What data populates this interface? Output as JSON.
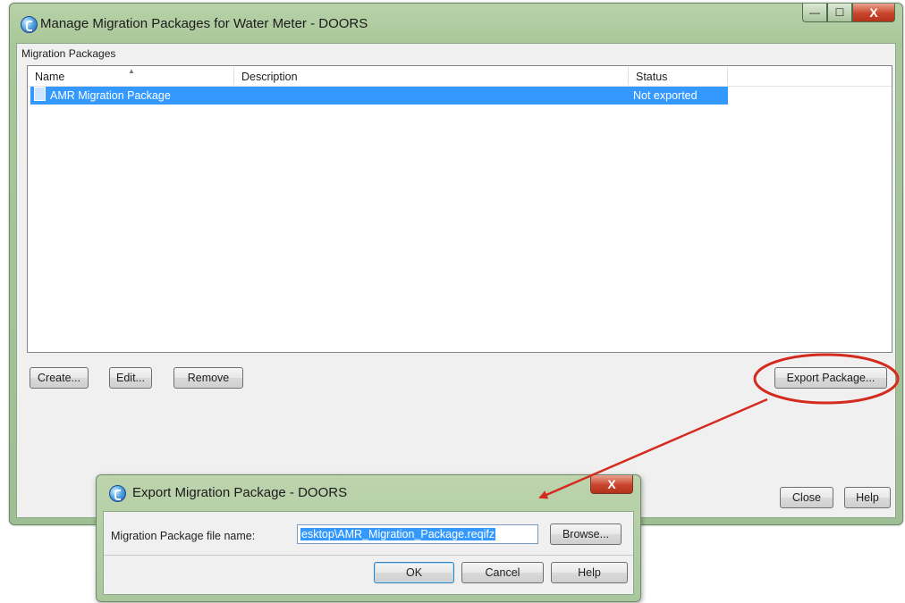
{
  "main_window": {
    "title": "Manage Migration Packages for Water Meter - DOORS",
    "group_label": "Migration Packages",
    "columns": {
      "name": "Name",
      "description": "Description",
      "status": "Status"
    },
    "rows": [
      {
        "name": "AMR Migration Package",
        "description": "",
        "status": "Not exported"
      }
    ],
    "buttons": {
      "create": "Create...",
      "edit": "Edit...",
      "remove": "Remove",
      "export": "Export Package...",
      "close": "Close",
      "help": "Help"
    },
    "caption": {
      "minimize": "—",
      "maximize": "☐",
      "close": "X"
    }
  },
  "export_dialog": {
    "title": "Export Migration Package - DOORS",
    "file_label": "Migration Package file name:",
    "file_value": "esktop\\AMR_Migration_Package.reqifz",
    "buttons": {
      "browse": "Browse...",
      "ok": "OK",
      "cancel": "Cancel",
      "help": "Help"
    },
    "caption_close": "X"
  },
  "colors": {
    "selection": "#3399ff",
    "frame": "#a8c89a",
    "annotation": "#d42b1e"
  }
}
